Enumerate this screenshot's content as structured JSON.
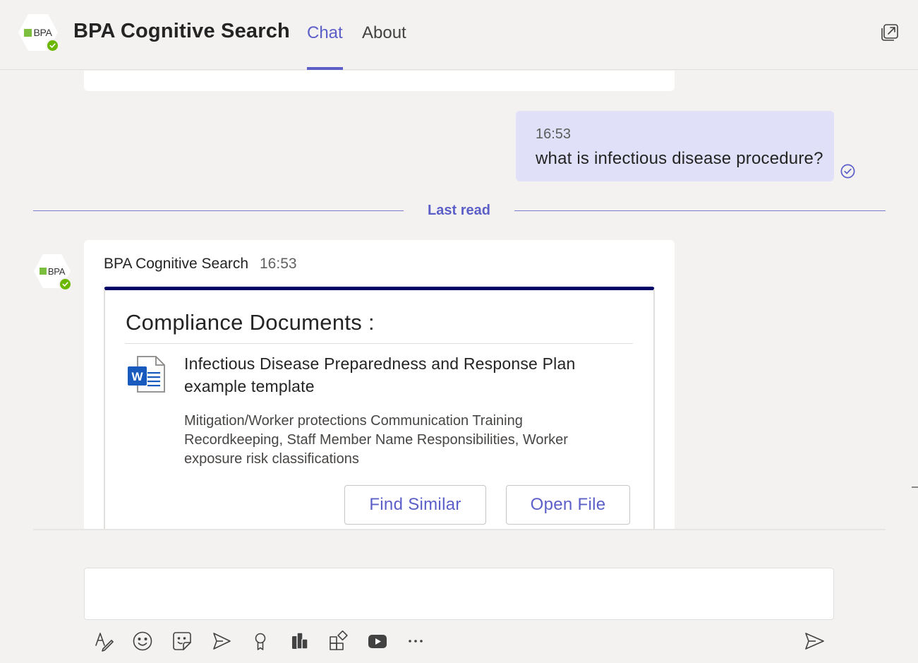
{
  "header": {
    "logo_text": "BPA",
    "app_title": "BPA Cognitive Search",
    "tabs": [
      {
        "label": "Chat",
        "active": true
      },
      {
        "label": "About",
        "active": false
      }
    ]
  },
  "colors": {
    "accent": "#5b5fc7",
    "card_top_border": "#000066",
    "status_green": "#6bb700",
    "logo_green": "#7cbf3f",
    "word_blue": "#185abd"
  },
  "messages": {
    "outgoing": {
      "time": "16:53",
      "text": "what is infectious disease procedure?"
    },
    "last_read_label": "Last read",
    "bot": {
      "sender": "BPA Cognitive Search",
      "time": "16:53",
      "card": {
        "title": "Compliance Documents :",
        "document": {
          "icon": "word-doc-icon",
          "title": "Infectious Disease Preparedness and Response Plan example template",
          "description": "Mitigation/Worker protections Communication Training Recordkeeping, Staff Member Name Responsibilities, Worker exposure risk classifications"
        },
        "buttons": {
          "find_similar": "Find Similar",
          "open_file": "Open File"
        }
      }
    }
  },
  "compose": {
    "placeholder": "",
    "toolbar_icons": [
      "format-icon",
      "emoji-icon",
      "sticker-icon",
      "schedule-send-icon",
      "praise-icon",
      "apps-icon",
      "more-apps-icon",
      "youtube-icon",
      "more-options-icon"
    ],
    "send_icon": "send-icon"
  }
}
